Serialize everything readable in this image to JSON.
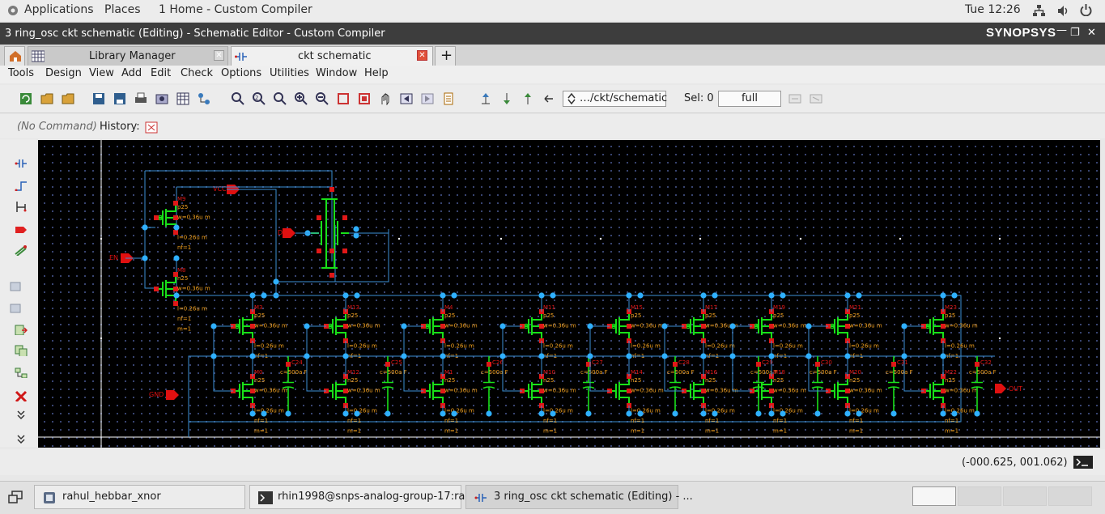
{
  "topbar": {
    "applications": "Applications",
    "places": "Places",
    "window_app": "1 Home - Custom Compiler",
    "clock": "Tue 12:26"
  },
  "window": {
    "title": "3 ring_osc ckt schematic (Editing) - Schematic Editor - Custom Compiler",
    "brand": "SYNOPSYS"
  },
  "tabs": [
    {
      "label": "Library Manager"
    },
    {
      "label": "ckt schematic"
    }
  ],
  "menus": [
    "Tools",
    "Design",
    "View",
    "Add",
    "Edit",
    "Check",
    "Options",
    "Utilities",
    "Window",
    "Help"
  ],
  "toolbar": {
    "path": "…/ckt/schematic",
    "sel_label": "Sel: 0",
    "view_mode": "full"
  },
  "command": {
    "prompt": "(No Command)",
    "history_label": "History:"
  },
  "status": {
    "coords": "(-000.625,  001.062)"
  },
  "taskbar": [
    {
      "label": "rahul_hebbar_xnor"
    },
    {
      "label": "rhin1998@snps-analog-group-17:ra..."
    },
    {
      "label": "3 ring_osc ckt schematic (Editing) - ..."
    }
  ],
  "schematic": {
    "pins": {
      "vcc": "VCC",
      "en": "EN",
      "gnd": "GND",
      "d": "D",
      "out": "OUT"
    },
    "header_tr": [
      {
        "name": "M9",
        "model": "p25",
        "w": "w=0.36u m",
        "l": "l=0.26u m",
        "nf": "nf=1"
      },
      {
        "name": "M8",
        "model": "n25",
        "w": "w=0.36u m",
        "l": "l=0.26u m",
        "nf": "nf=1",
        "m": "m=1"
      }
    ],
    "top_tr": [
      "M3",
      "M13",
      "M4",
      "M11",
      "M15",
      "M17",
      "M19",
      "M21",
      "M23"
    ],
    "bottom_tr": [
      "M0",
      "M12",
      "M1",
      "M10",
      "M14",
      "M16",
      "M18",
      "M20",
      "M22"
    ],
    "caps": [
      "C24",
      "C25",
      "C26",
      "C27",
      "C28",
      "C29",
      "C30",
      "C31",
      "C32"
    ],
    "p_model": "p25",
    "n_model": "n25",
    "w_text": "w=0.36u m",
    "l_text": "l=0.26u m",
    "nf_text": "nf=1",
    "m_text": "m=1",
    "cap_value": "c=500a F"
  }
}
